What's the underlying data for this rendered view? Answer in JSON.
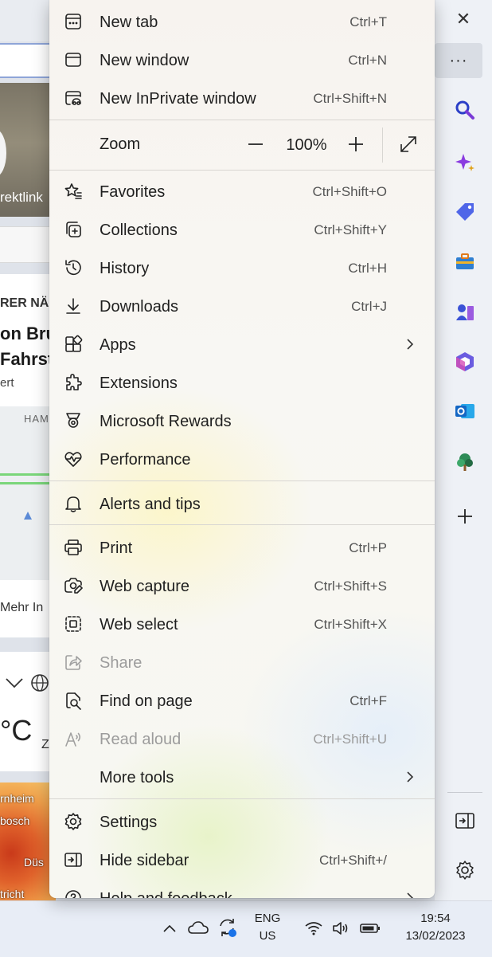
{
  "background": {
    "hero_link_text": "rektlink",
    "news_kicker": "RER NÄ",
    "news_headline_1": "on Bru",
    "news_headline_2": "Fahrst",
    "news_subline": "ert",
    "map_label": "HAM",
    "more_info": "Mehr In",
    "weather_temp": "°C",
    "weather_sub": "Z",
    "heatmap_labels": [
      "rnheim",
      "bosch",
      "Düs",
      "tricht"
    ]
  },
  "menu": {
    "items_top": [
      {
        "label": "New tab",
        "shortcut": "Ctrl+T",
        "icon": "new-tab-icon"
      },
      {
        "label": "New window",
        "shortcut": "Ctrl+N",
        "icon": "new-window-icon"
      },
      {
        "label": "New InPrivate window",
        "shortcut": "Ctrl+Shift+N",
        "icon": "inprivate-icon"
      }
    ],
    "zoom": {
      "label": "Zoom",
      "value": "100%",
      "minus": "−",
      "plus": "+"
    },
    "items_mid": [
      {
        "label": "Favorites",
        "shortcut": "Ctrl+Shift+O",
        "icon": "favorites-icon"
      },
      {
        "label": "Collections",
        "shortcut": "Ctrl+Shift+Y",
        "icon": "collections-icon"
      },
      {
        "label": "History",
        "shortcut": "Ctrl+H",
        "icon": "history-icon"
      },
      {
        "label": "Downloads",
        "shortcut": "Ctrl+J",
        "icon": "downloads-icon"
      },
      {
        "label": "Apps",
        "shortcut": "",
        "icon": "apps-icon"
      },
      {
        "label": "Extensions",
        "shortcut": "",
        "icon": "extensions-icon"
      },
      {
        "label": "Microsoft Rewards",
        "shortcut": "",
        "icon": "rewards-icon"
      },
      {
        "label": "Performance",
        "shortcut": "",
        "icon": "performance-icon"
      }
    ],
    "alerts": {
      "label": "Alerts and tips",
      "icon": "bell-icon"
    },
    "items_tools": [
      {
        "label": "Print",
        "shortcut": "Ctrl+P",
        "icon": "print-icon"
      },
      {
        "label": "Web capture",
        "shortcut": "Ctrl+Shift+S",
        "icon": "web-capture-icon"
      },
      {
        "label": "Web select",
        "shortcut": "Ctrl+Shift+X",
        "icon": "web-select-icon"
      },
      {
        "label": "Share",
        "shortcut": "",
        "icon": "share-icon",
        "disabled": true
      },
      {
        "label": "Find on page",
        "shortcut": "Ctrl+F",
        "icon": "find-icon"
      },
      {
        "label": "Read aloud",
        "shortcut": "Ctrl+Shift+U",
        "icon": "read-aloud-icon",
        "disabled": true
      },
      {
        "label": "More tools",
        "shortcut": "",
        "icon": ""
      }
    ],
    "items_bottom": [
      {
        "label": "Settings",
        "shortcut": "",
        "icon": "settings-icon"
      },
      {
        "label": "Hide sidebar",
        "shortcut": "Ctrl+Shift+/",
        "icon": "hide-sidebar-icon"
      },
      {
        "label": "Help and feedback",
        "shortcut": "",
        "icon": "help-icon"
      }
    ]
  },
  "sidebar": {
    "more_button": "···",
    "close_glyph": "✕",
    "icons": [
      "search-icon",
      "copilot-icon",
      "shopping-icon",
      "tools-icon",
      "games-icon",
      "office-icon",
      "outlook-icon",
      "tree-icon",
      "add-icon"
    ],
    "bottom_icons": [
      "sidebar-toggle-icon",
      "settings-icon"
    ]
  },
  "taskbar": {
    "lang_line1": "ENG",
    "lang_line2": "US",
    "time": "19:54",
    "date": "13/02/2023"
  },
  "colors": {
    "search": "#2b3fc7",
    "copilot": "#8a3be0",
    "shopping": "#4f66e8",
    "office": "#6a5ce0",
    "outlook": "#1467c4",
    "tree": "#2e8b57"
  }
}
